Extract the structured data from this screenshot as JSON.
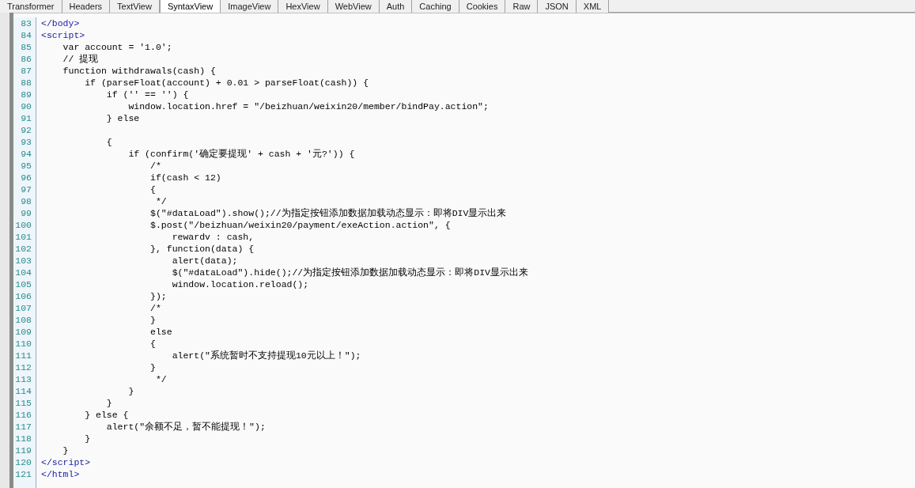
{
  "tabs": [
    {
      "label": "Transformer",
      "selected": false
    },
    {
      "label": "Headers",
      "selected": false
    },
    {
      "label": "TextView",
      "selected": false
    },
    {
      "label": "SyntaxView",
      "selected": true
    },
    {
      "label": "ImageView",
      "selected": false
    },
    {
      "label": "HexView",
      "selected": false
    },
    {
      "label": "WebView",
      "selected": false
    },
    {
      "label": "Auth",
      "selected": false
    },
    {
      "label": "Caching",
      "selected": false
    },
    {
      "label": "Cookies",
      "selected": false
    },
    {
      "label": "Raw",
      "selected": false
    },
    {
      "label": "JSON",
      "selected": false
    },
    {
      "label": "XML",
      "selected": false
    }
  ],
  "code_lines": [
    {
      "number": "83",
      "kind": "tag",
      "text": "</body>"
    },
    {
      "number": "84",
      "kind": "tag",
      "text": "<script>"
    },
    {
      "number": "85",
      "kind": "code",
      "text": "    var account = '1.0';"
    },
    {
      "number": "86",
      "kind": "code",
      "text": "    // 提现"
    },
    {
      "number": "87",
      "kind": "code",
      "text": "    function withdrawals(cash) {"
    },
    {
      "number": "88",
      "kind": "code",
      "text": "        if (parseFloat(account) + 0.01 > parseFloat(cash)) {"
    },
    {
      "number": "89",
      "kind": "code",
      "text": "            if ('' == '') {"
    },
    {
      "number": "90",
      "kind": "code",
      "text": "                window.location.href = \"/beizhuan/weixin20/member/bindPay.action\";"
    },
    {
      "number": "91",
      "kind": "code",
      "text": "            } else"
    },
    {
      "number": "92"
    },
    {
      "number": "93",
      "kind": "code",
      "text": "            {"
    },
    {
      "number": "94",
      "kind": "code",
      "text": "                if (confirm('确定要提现' + cash + '元?')) {"
    },
    {
      "number": "95",
      "kind": "code",
      "text": "                    /*"
    },
    {
      "number": "96",
      "kind": "code",
      "text": "                    if(cash < 12)"
    },
    {
      "number": "97",
      "kind": "code",
      "text": "                    {"
    },
    {
      "number": "98",
      "kind": "code",
      "text": "                     */"
    },
    {
      "number": "99",
      "kind": "code",
      "text": "                    $(\"#dataLoad\").show();//为指定按钮添加数据加载动态显示：即将DIV显示出来"
    },
    {
      "number": "100",
      "kind": "code",
      "text": "                    $.post(\"/beizhuan/weixin20/payment/exeAction.action\", {"
    },
    {
      "number": "101",
      "kind": "code",
      "text": "                        rewardv : cash,"
    },
    {
      "number": "102",
      "kind": "code",
      "text": "                    }, function(data) {"
    },
    {
      "number": "103",
      "kind": "code",
      "text": "                        alert(data);"
    },
    {
      "number": "104",
      "kind": "code",
      "text": "                        $(\"#dataLoad\").hide();//为指定按钮添加数据加载动态显示：即将DIV显示出来"
    },
    {
      "number": "105",
      "kind": "code",
      "text": "                        window.location.reload();"
    },
    {
      "number": "106",
      "kind": "code",
      "text": "                    });"
    },
    {
      "number": "107",
      "kind": "code",
      "text": "                    /*"
    },
    {
      "number": "108",
      "kind": "code",
      "text": "                    }"
    },
    {
      "number": "109",
      "kind": "code",
      "text": "                    else"
    },
    {
      "number": "110",
      "kind": "code",
      "text": "                    {"
    },
    {
      "number": "111",
      "kind": "code",
      "text": "                        alert(\"系统暂时不支持提现10元以上！\");"
    },
    {
      "number": "112",
      "kind": "code",
      "text": "                    }"
    },
    {
      "number": "113",
      "kind": "code",
      "text": "                     */"
    },
    {
      "number": "114",
      "kind": "code",
      "text": "                }"
    },
    {
      "number": "115",
      "kind": "code",
      "text": "            }"
    },
    {
      "number": "116",
      "kind": "code",
      "text": "        } else {"
    },
    {
      "number": "117",
      "kind": "code",
      "text": "            alert(\"余额不足，暂不能提现！\");"
    },
    {
      "number": "118",
      "kind": "code",
      "text": "        }"
    },
    {
      "number": "119",
      "kind": "code",
      "text": "    }"
    },
    {
      "number": "120",
      "kind": "tag",
      "text": "</script>"
    },
    {
      "number": "121",
      "kind": "tag",
      "text": "</html>"
    }
  ]
}
